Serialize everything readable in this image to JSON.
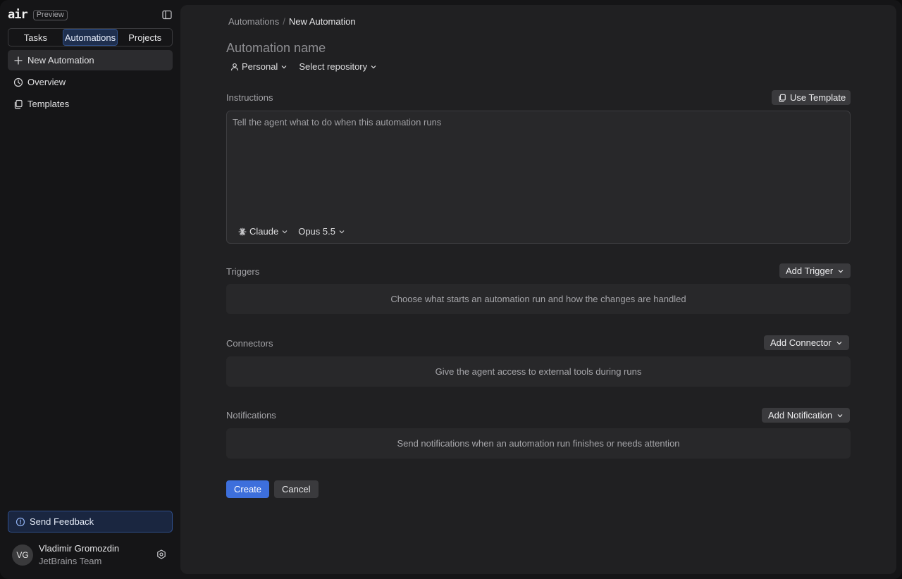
{
  "app": {
    "logo_text": "air",
    "badge": "Preview"
  },
  "sidebar": {
    "tabs": [
      {
        "label": "Tasks",
        "active": false
      },
      {
        "label": "Automations",
        "active": true
      },
      {
        "label": "Projects",
        "active": false
      }
    ],
    "nav": [
      {
        "label": "New Automation",
        "icon": "plus-icon",
        "active": true
      },
      {
        "label": "Overview",
        "icon": "clock-icon",
        "active": false
      },
      {
        "label": "Templates",
        "icon": "copy-icon",
        "active": false
      }
    ],
    "feedback_label": "Send Feedback",
    "user": {
      "initials": "VG",
      "name": "Vladimir Gromozdin",
      "team": "JetBrains Team"
    }
  },
  "breadcrumb": {
    "parent": "Automations",
    "separator": "/",
    "current": "New Automation"
  },
  "form": {
    "name_placeholder": "Automation name",
    "owner": "Personal",
    "repository": "Select repository",
    "instructions": {
      "label": "Instructions",
      "template_button": "Use Template",
      "placeholder": "Tell the agent what to do when this automation runs",
      "agent": "Claude",
      "model": "Opus 5.5"
    },
    "triggers": {
      "label": "Triggers",
      "button": "Add Trigger",
      "empty_text": "Choose what starts an automation run and how the changes are handled"
    },
    "connectors": {
      "label": "Connectors",
      "button": "Add Connector",
      "empty_text": "Give the agent access to external tools during runs"
    },
    "notifications": {
      "label": "Notifications",
      "button": "Add Notification",
      "empty_text": "Send notifications when an automation run finishes or needs attention"
    },
    "create_label": "Create",
    "cancel_label": "Cancel"
  },
  "colors": {
    "accent": "#3d6fdc",
    "sidebar_bg": "#151517",
    "main_bg": "#202022"
  }
}
